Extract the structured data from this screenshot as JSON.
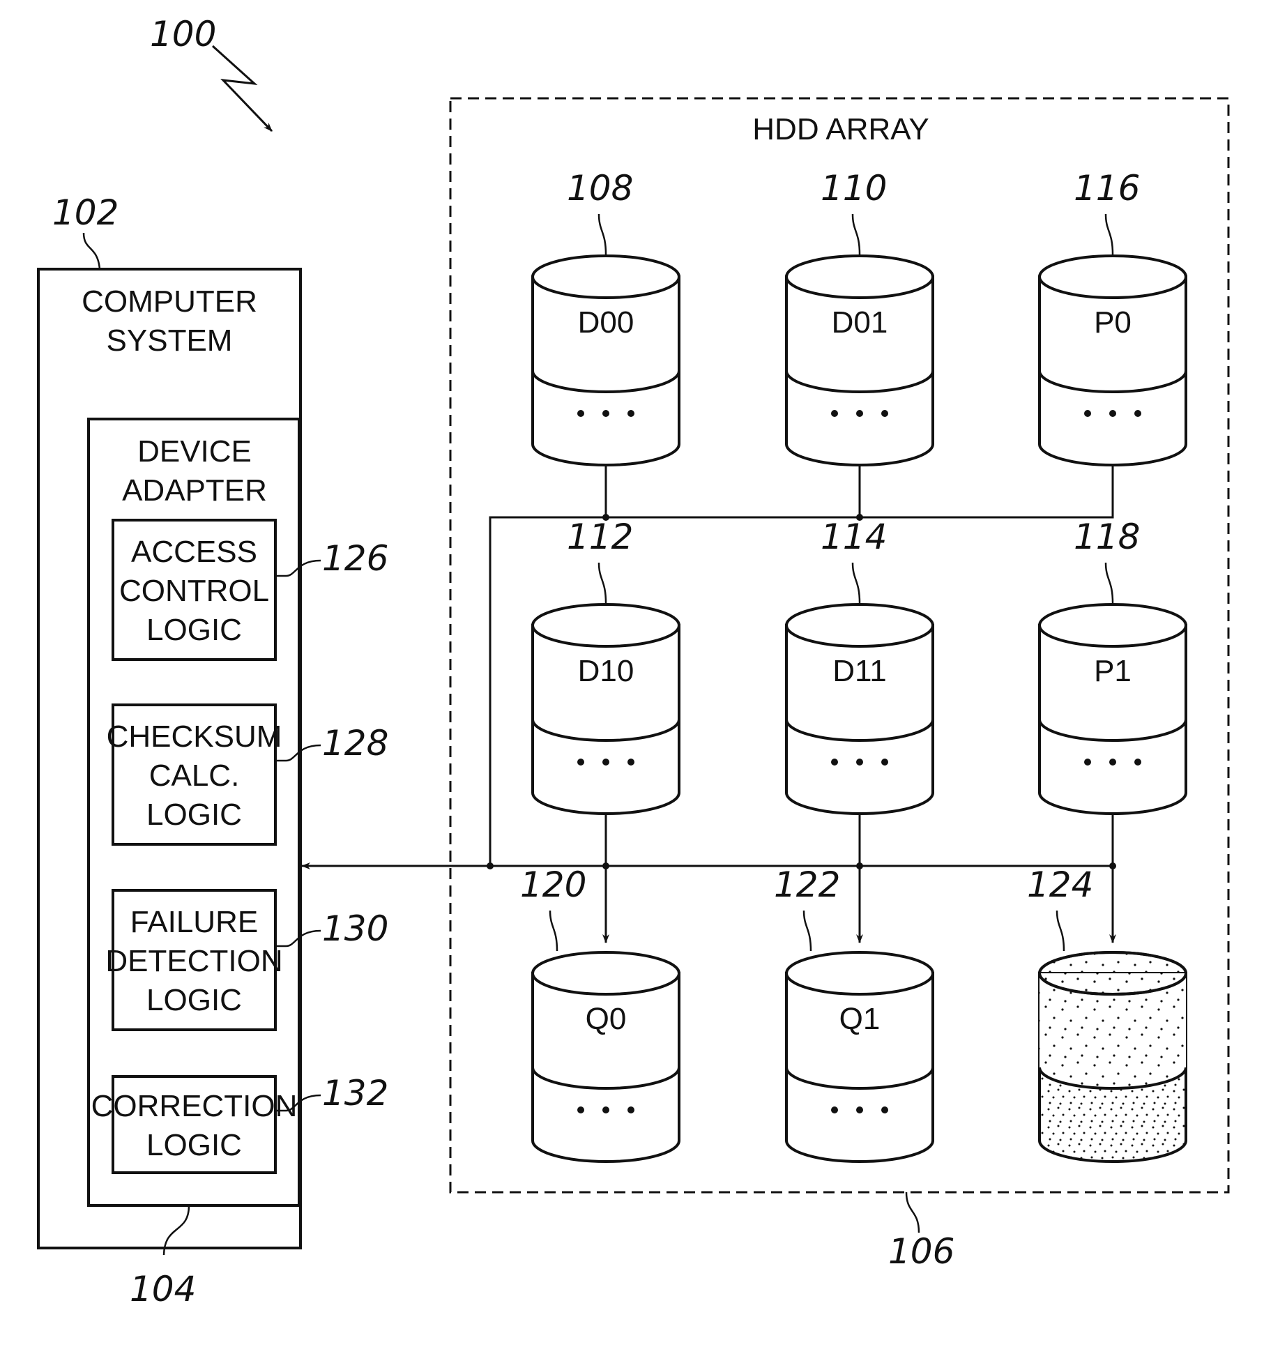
{
  "figure_ref": "100",
  "computer_system": {
    "ref": "102",
    "label_lines": [
      "COMPUTER",
      "SYSTEM"
    ]
  },
  "device_adapter": {
    "ref": "104",
    "label_lines": [
      "DEVICE",
      "ADAPTER"
    ],
    "modules": [
      {
        "ref": "126",
        "label_lines": [
          "ACCESS",
          "CONTROL",
          "LOGIC"
        ]
      },
      {
        "ref": "128",
        "label_lines": [
          "CHECKSUM",
          "CALC.",
          "LOGIC"
        ]
      },
      {
        "ref": "130",
        "label_lines": [
          "FAILURE",
          "DETECTION",
          "LOGIC"
        ]
      },
      {
        "ref": "132",
        "label_lines": [
          "CORRECTION",
          "LOGIC"
        ]
      }
    ]
  },
  "hdd_array": {
    "ref": "106",
    "title": "HDD ARRAY",
    "disks": [
      {
        "ref": "108",
        "label": "D00",
        "content": "ellipsis",
        "row": 0,
        "col": 0
      },
      {
        "ref": "110",
        "label": "D01",
        "content": "ellipsis",
        "row": 0,
        "col": 1
      },
      {
        "ref": "116",
        "label": "P0",
        "content": "ellipsis",
        "row": 0,
        "col": 2
      },
      {
        "ref": "112",
        "label": "D10",
        "content": "ellipsis",
        "row": 1,
        "col": 0
      },
      {
        "ref": "114",
        "label": "D11",
        "content": "ellipsis",
        "row": 1,
        "col": 1
      },
      {
        "ref": "118",
        "label": "P1",
        "content": "ellipsis",
        "row": 1,
        "col": 2
      },
      {
        "ref": "120",
        "label": "Q0",
        "content": "ellipsis",
        "row": 2,
        "col": 0
      },
      {
        "ref": "122",
        "label": "Q1",
        "content": "ellipsis",
        "row": 2,
        "col": 1
      },
      {
        "ref": "124",
        "label": "",
        "content": "stippled",
        "row": 2,
        "col": 2
      }
    ],
    "ellipsis_text": "• • •"
  }
}
